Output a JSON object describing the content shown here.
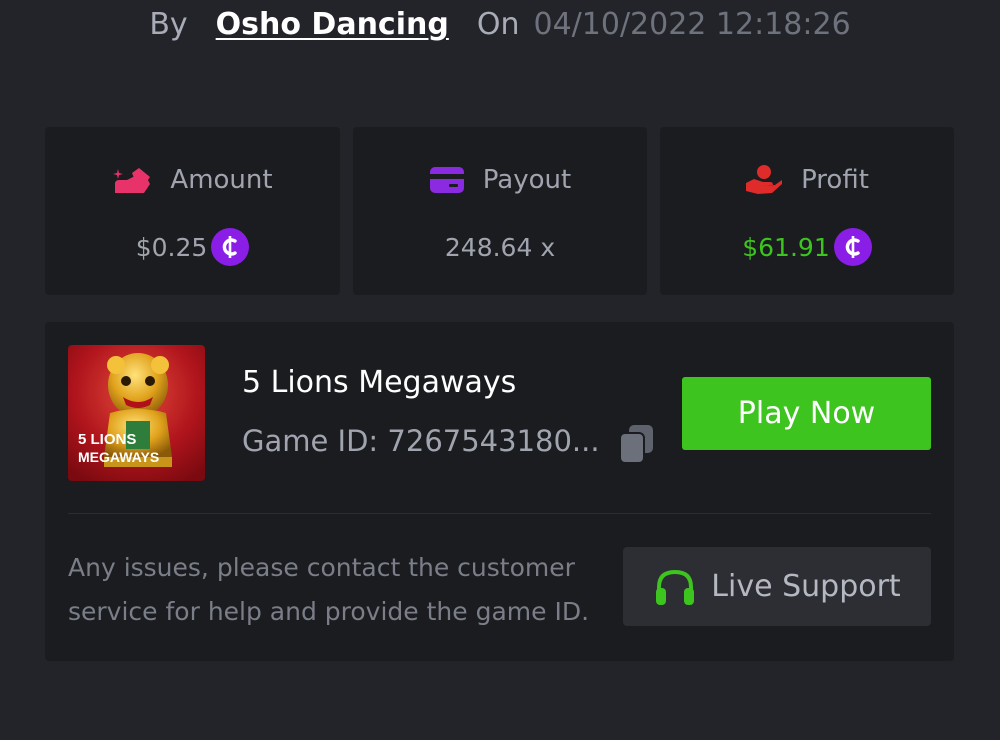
{
  "byline": {
    "by_label": "By",
    "author": "Osho Dancing",
    "on_label": "On",
    "datetime": "04/10/2022 12:18:26"
  },
  "stats": [
    {
      "label": "Amount",
      "value": "$0.25",
      "icon": "coins-hand-icon",
      "currency_icon": "coin-icon"
    },
    {
      "label": "Payout",
      "value": "248.64 x",
      "icon": "card-icon"
    },
    {
      "label": "Profit",
      "value": "$61.91",
      "icon": "hand-profit-icon",
      "currency_icon": "coin-icon"
    }
  ],
  "game": {
    "title": "5 Lions Megaways",
    "id_label": "Game ID: 7267543180...",
    "thumbnail_text_line1": "5 LIONS",
    "thumbnail_text_line2": "MEGAWAYS",
    "play_button": "Play Now",
    "help_text": "Any issues, please contact the customer service for help and provide the game ID.",
    "support_button": "Live Support"
  },
  "colors": {
    "background": "#232429",
    "card": "#1b1c20",
    "accent_green": "#3dc41f",
    "coin_purple": "#8a1ee6",
    "amount_icon_pink": "#e8326a",
    "payout_icon_purple": "#8a2be2",
    "profit_icon_red": "#e02b2b"
  }
}
